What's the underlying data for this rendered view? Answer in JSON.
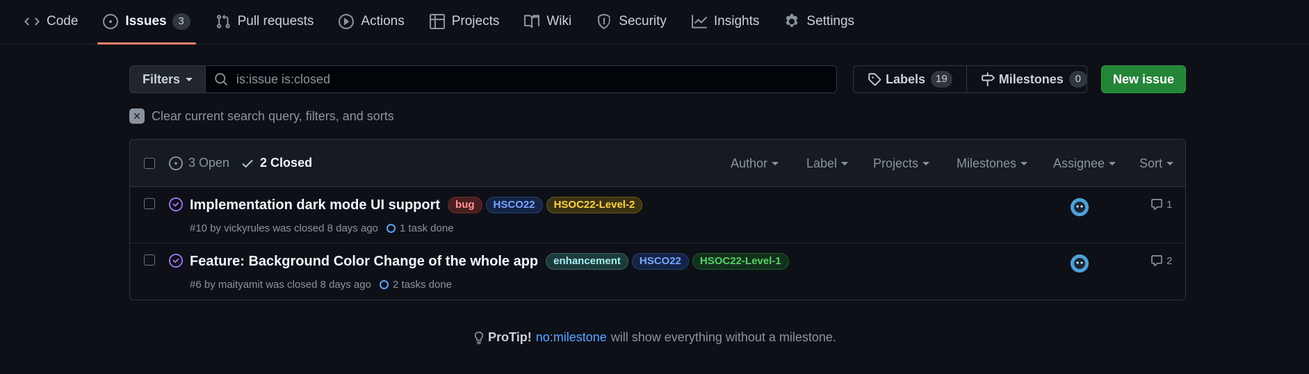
{
  "tabs": [
    {
      "label": "Code",
      "icon": "code-icon"
    },
    {
      "label": "Issues",
      "icon": "issue-opened-icon",
      "count": "3",
      "selected": true
    },
    {
      "label": "Pull requests",
      "icon": "pull-request-icon"
    },
    {
      "label": "Actions",
      "icon": "play-icon"
    },
    {
      "label": "Projects",
      "icon": "table-icon"
    },
    {
      "label": "Wiki",
      "icon": "book-icon"
    },
    {
      "label": "Security",
      "icon": "shield-icon"
    },
    {
      "label": "Insights",
      "icon": "graph-icon"
    },
    {
      "label": "Settings",
      "icon": "gear-icon"
    }
  ],
  "toolbar": {
    "filters_label": "Filters",
    "search_value": "is:issue is:closed",
    "labels_label": "Labels",
    "labels_count": "19",
    "milestones_label": "Milestones",
    "milestones_count": "0",
    "new_issue_label": "New issue"
  },
  "clear_text": "Clear current search query, filters, and sorts",
  "header": {
    "open_label": "3 Open",
    "closed_label": "2 Closed",
    "filters": [
      "Author",
      "Label",
      "Projects",
      "Milestones",
      "Assignee",
      "Sort"
    ]
  },
  "issues": [
    {
      "title": "Implementation dark mode UI support",
      "labels": [
        {
          "text": "bug",
          "color": "#f85149"
        },
        {
          "text": "HSCO22",
          "color": "#79a6ff"
        },
        {
          "text": "HSOC22-Level-2",
          "color": "#e3b341"
        }
      ],
      "meta": "#10 by vickyrules was closed 8 days ago",
      "tasks": "1 task done",
      "comments": "1"
    },
    {
      "title": "Feature: Background Color Change of the whole app",
      "labels": [
        {
          "text": "enhancement",
          "color": "#a2eeef"
        },
        {
          "text": "HSCO22",
          "color": "#79a6ff"
        },
        {
          "text": "HSOC22-Level-1",
          "color": "#3fb950"
        }
      ],
      "meta": "#6 by maityamit was closed 8 days ago",
      "tasks": "2 tasks done",
      "comments": "2"
    }
  ],
  "protip": {
    "label": "ProTip!",
    "link": "no:milestone",
    "text": "will show everything without a milestone."
  },
  "colors": {
    "accent_underline": "#f78166",
    "new_issue_bg": "#238636",
    "closed_issue_icon": "#a371f7",
    "link": "#58a6ff"
  }
}
